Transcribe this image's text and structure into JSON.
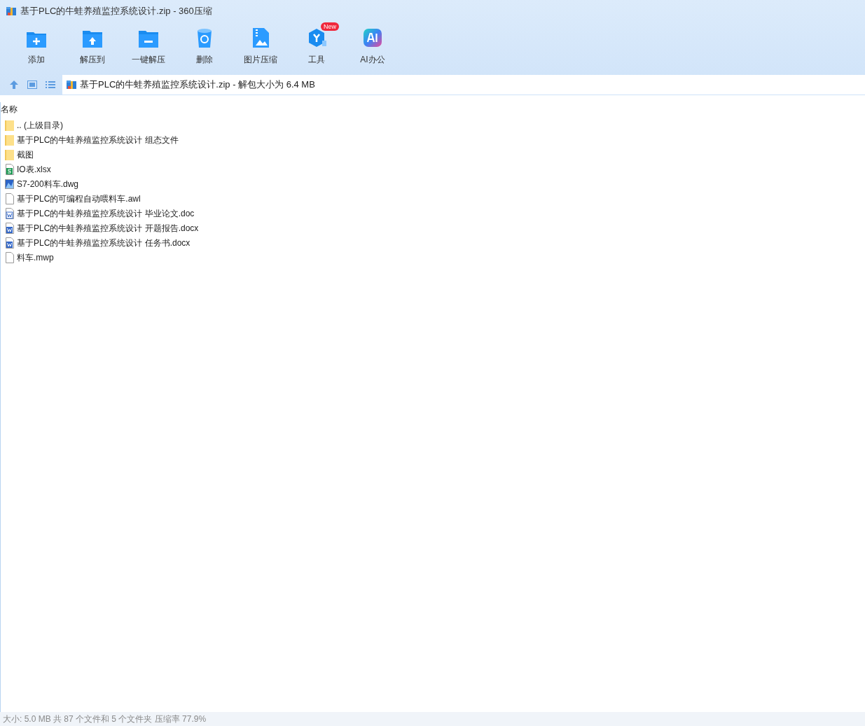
{
  "window": {
    "title": "基于PLC的牛蛙养殖监控系统设计.zip - 360压缩"
  },
  "toolbar": [
    {
      "kind": "add",
      "label": "添加"
    },
    {
      "kind": "extract",
      "label": "解压到"
    },
    {
      "kind": "oneclick",
      "label": "一键解压"
    },
    {
      "kind": "delete",
      "label": "删除"
    },
    {
      "kind": "image",
      "label": "图片压缩"
    },
    {
      "kind": "tools",
      "label": "工具",
      "badge": "New"
    },
    {
      "kind": "ai",
      "label": "AI办公"
    }
  ],
  "address": {
    "path": "基于PLC的牛蛙养殖监控系统设计.zip - 解包大小为 6.4 MB"
  },
  "table": {
    "columns": [
      "名称"
    ],
    "rows": [
      {
        "kind": "folder",
        "name": ".. (上级目录)"
      },
      {
        "kind": "folder",
        "name": "基于PLC的牛蛙养殖监控系统设计 组态文件"
      },
      {
        "kind": "folder",
        "name": "截图"
      },
      {
        "kind": "xlsx",
        "name": "IO表.xlsx"
      },
      {
        "kind": "dwg",
        "name": "S7-200料车.dwg"
      },
      {
        "kind": "file",
        "name": "基于PLC的可编程自动喂料车.awl"
      },
      {
        "kind": "doc",
        "name": "基于PLC的牛蛙养殖监控系统设计 毕业论文.doc"
      },
      {
        "kind": "docx",
        "name": "基于PLC的牛蛙养殖监控系统设计 开题报告.docx"
      },
      {
        "kind": "docx",
        "name": "基于PLC的牛蛙养殖监控系统设计 任务书.docx"
      },
      {
        "kind": "file",
        "name": "料车.mwp"
      }
    ]
  },
  "status_bar": "大小: 5.0 MB 共 87 个文件和 5 个文件夹 压缩率 77.9%"
}
